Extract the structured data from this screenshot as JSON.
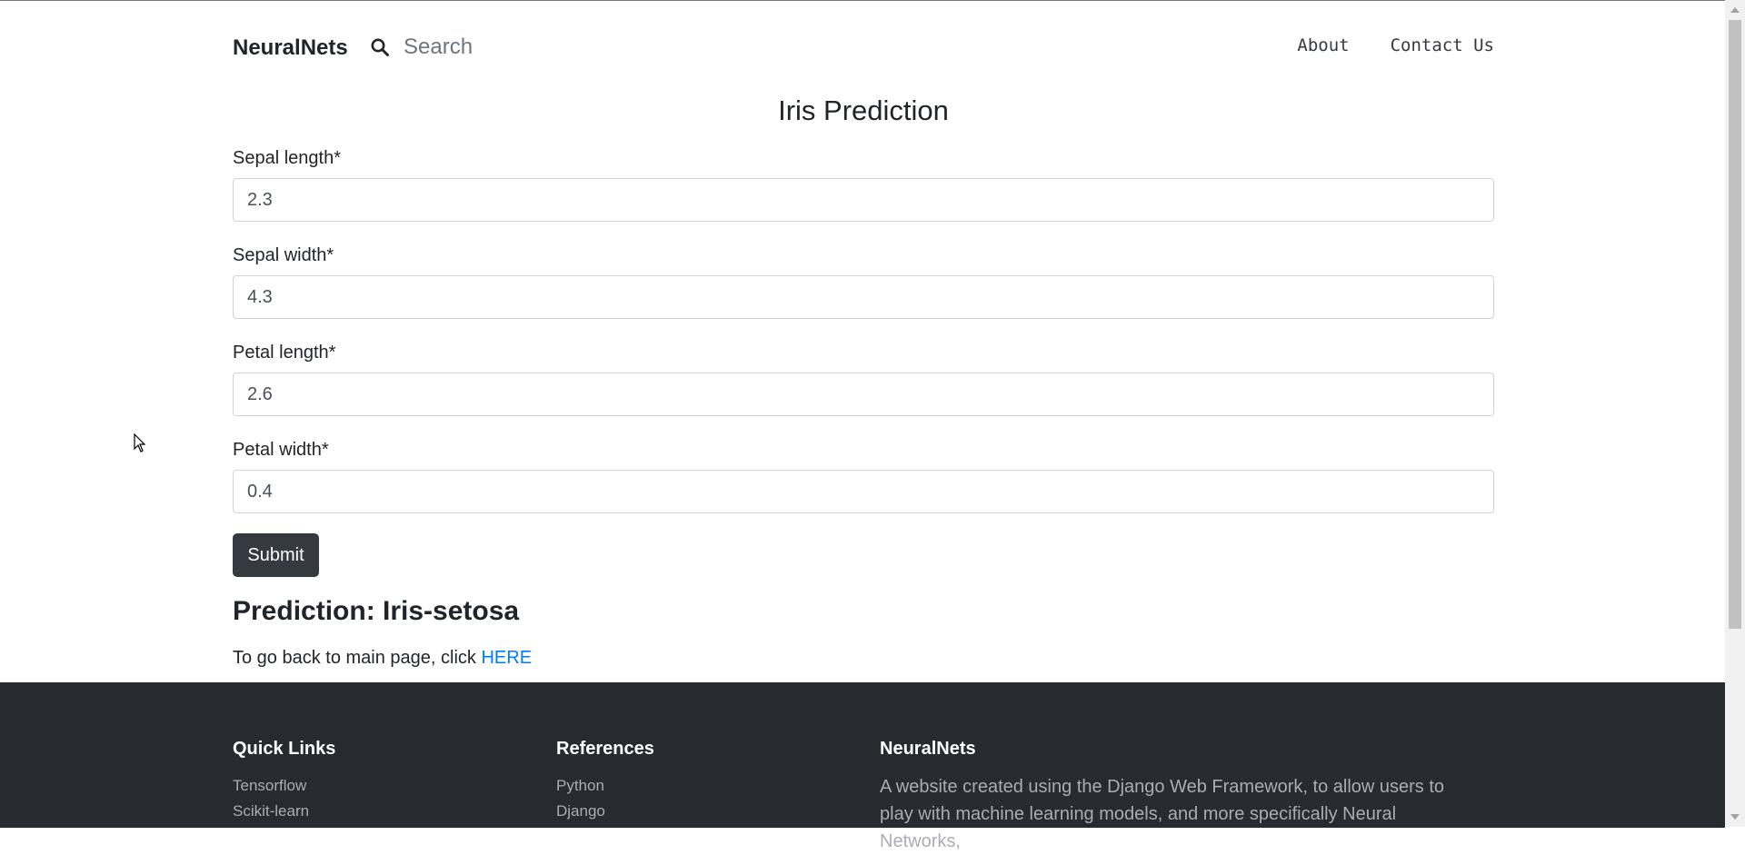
{
  "nav": {
    "brand": "NeuralNets",
    "search_placeholder": "Search",
    "links": [
      "About",
      "Contact Us"
    ]
  },
  "form": {
    "title": "Iris Prediction",
    "fields": [
      {
        "label": "Sepal length*",
        "value": "2.3"
      },
      {
        "label": "Sepal width*",
        "value": "4.3"
      },
      {
        "label": "Petal length*",
        "value": "2.6"
      },
      {
        "label": "Petal width*",
        "value": "0.4"
      }
    ],
    "submit_label": "Submit"
  },
  "result": {
    "prediction": "Prediction: Iris-setosa",
    "back_text": "To go back to main page, click ",
    "back_link": "HERE"
  },
  "footer": {
    "quick_links": {
      "title": "Quick Links",
      "items": [
        "Tensorflow",
        "Scikit-learn"
      ]
    },
    "references": {
      "title": "References",
      "items": [
        "Python",
        "Django"
      ]
    },
    "about": {
      "title": "NeuralNets",
      "text": "A website created using the Django Web Framework, to allow users to play with machine learning models, and more specifically Neural Networks,"
    }
  },
  "icons": {
    "search": "search-icon",
    "cursor": "mouse-cursor-icon"
  },
  "colors": {
    "link": "#007bff",
    "button": "#343a40",
    "footer_bg": "#272b30"
  }
}
